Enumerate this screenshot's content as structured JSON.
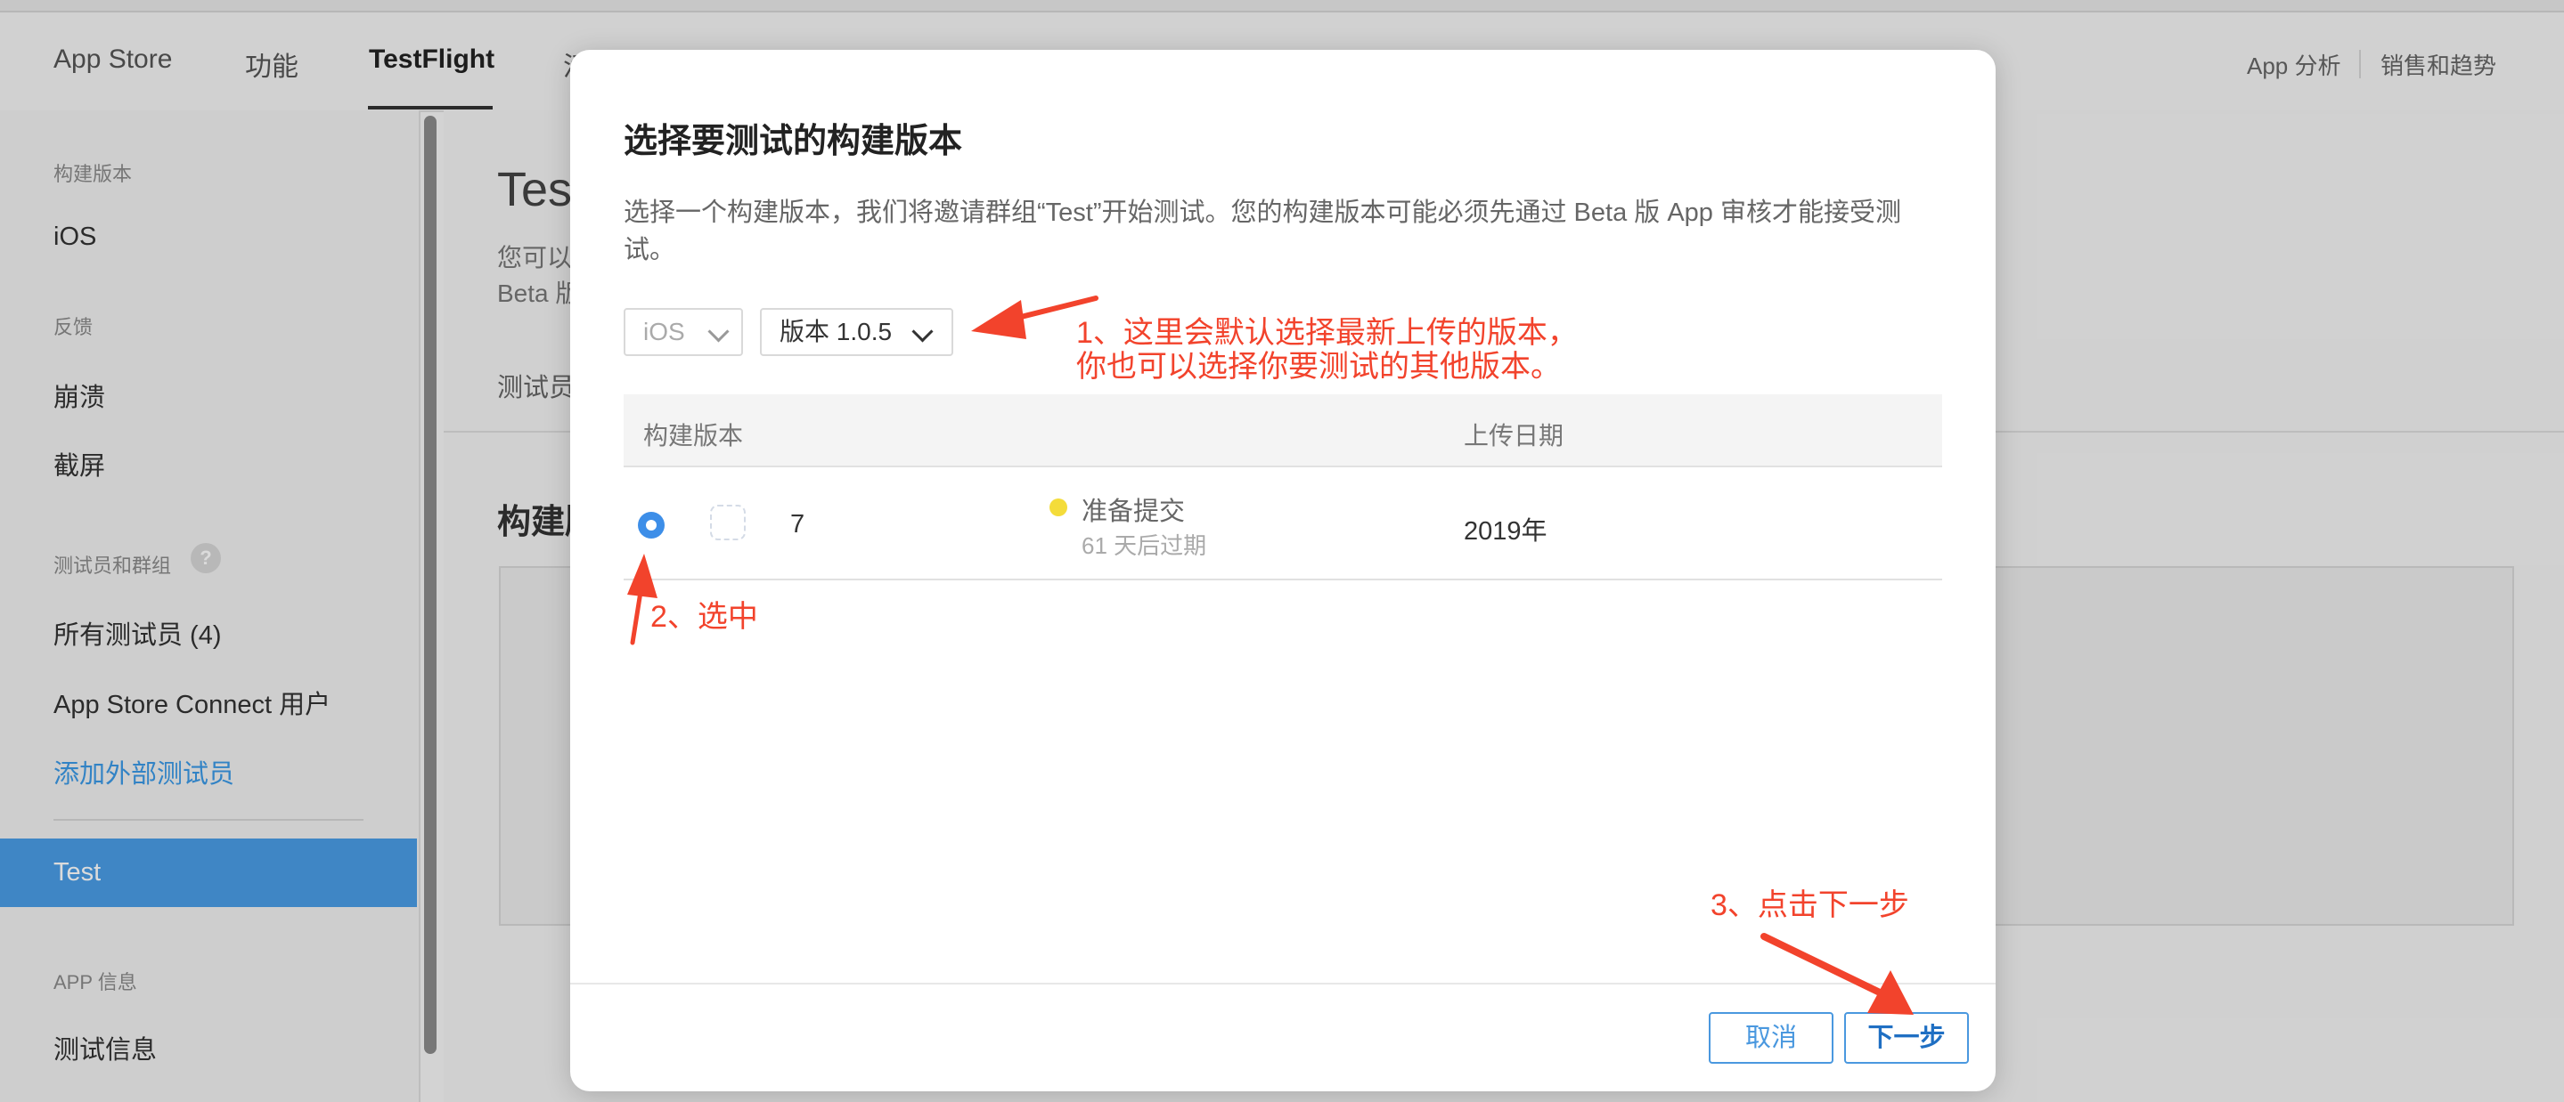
{
  "top_nav": {
    "tabs": [
      "App Store",
      "功能",
      "TestFlight",
      "活"
    ],
    "right_links": [
      "App 分析",
      "销售和趋势"
    ]
  },
  "sidebar": {
    "section_builds": "构建版本",
    "item_ios": "iOS",
    "section_feedback": "反馈",
    "item_crashes": "崩溃",
    "item_screenshots": "截屏",
    "section_testers": "测试员和群组",
    "help_symbol": "?",
    "item_all_testers": "所有测试员 (4)",
    "item_connect_users": "App Store Connect 用户",
    "item_add_external": "添加外部测试员",
    "item_active_group": "Test",
    "section_app_info": "APP 信息",
    "item_test_info": "测试信息"
  },
  "main": {
    "title": "Test",
    "desc_line1": "您可以",
    "desc_line2": "Beta 版",
    "tab_label": "测试员",
    "section_title": "构建版"
  },
  "modal": {
    "title": "选择要测试的构建版本",
    "description": "选择一个构建版本，我们将邀请群组“Test”开始测试。您的构建版本可能必须先通过 Beta 版 App 审核才能接受测试。",
    "platform_select": "iOS",
    "version_select": "版本 1.0.5",
    "columns": [
      "构建版本",
      "上传日期"
    ],
    "rows": [
      {
        "build": "7",
        "status": "准备提交",
        "expiry": "61 天后过期",
        "upload_date": "2019年"
      }
    ],
    "cancel_label": "取消",
    "next_label": "下一步"
  },
  "annotations": {
    "note1_line1": "1、这里会默认选择最新上传的版本，",
    "note1_line2": "你也可以选择你要测试的其他版本。",
    "note2": "2、选中",
    "note3": "3、点击下一步"
  },
  "colors": {
    "accent": "#4a9de6",
    "annotation": "#f2432c",
    "status_dot": "#f4dc3a"
  }
}
